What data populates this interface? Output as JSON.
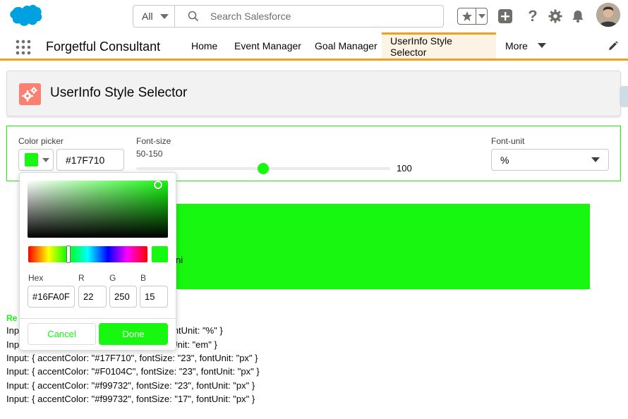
{
  "colors": {
    "accent": "#17F710",
    "picker_color": "#16FA0F",
    "salesforce_blue": "#00a1e0",
    "nav_accent": "#f2a01c",
    "icon_bg": "#fa8071"
  },
  "global_header": {
    "search_scope": "All",
    "search_placeholder": "Search Salesforce",
    "icons": [
      "salesforce-cloud-icon",
      "search-icon",
      "star-icon",
      "plus-icon",
      "help-icon",
      "gear-icon",
      "bell-icon",
      "avatar"
    ]
  },
  "app_nav": {
    "app_name": "Forgetful Consultant",
    "items": [
      {
        "label": "Home"
      },
      {
        "label": "Event Manager"
      },
      {
        "label": "Goal Manager"
      },
      {
        "label": "UserInfo Style Selector",
        "active": true
      },
      {
        "label": "More"
      }
    ]
  },
  "page_header": {
    "title": "UserInfo Style Selector"
  },
  "style_form": {
    "color_label": "Color picker",
    "color_value": "#17F710",
    "font_size_label": "Font-size",
    "font_size_range": "50-150",
    "font_size_value": "100",
    "font_size_min": 50,
    "font_size_max": 150,
    "font_unit_label": "Font-unit",
    "font_unit_value": "%"
  },
  "preview": {
    "text_fragment": "ni"
  },
  "color_picker": {
    "hex_label": "Hex",
    "r_label": "R",
    "g_label": "G",
    "b_label": "B",
    "hex": "#16FA0F",
    "r": "22",
    "g": "250",
    "b": "15",
    "cancel_label": "Cancel",
    "done_label": "Done"
  },
  "results": {
    "title_fragment": "Re",
    "lines": [
      "Inp                                           e: \"100\", fontUnit: \"%\" }",
      "Inp                                           e: \"5\", fontUnit: \"em\" }",
      "Input: { accentColor: \"#17F710\", fontSize: \"23\", fontUnit: \"px\" }",
      "Input: { accentColor: \"#F0104C\", fontSize: \"23\", fontUnit: \"px\" }",
      "Input: { accentColor: \"#f99732\", fontSize: \"23\", fontUnit: \"px\" }",
      "Input: { accentColor: \"#f99732\", fontSize: \"17\", fontUnit: \"px\" }"
    ]
  }
}
